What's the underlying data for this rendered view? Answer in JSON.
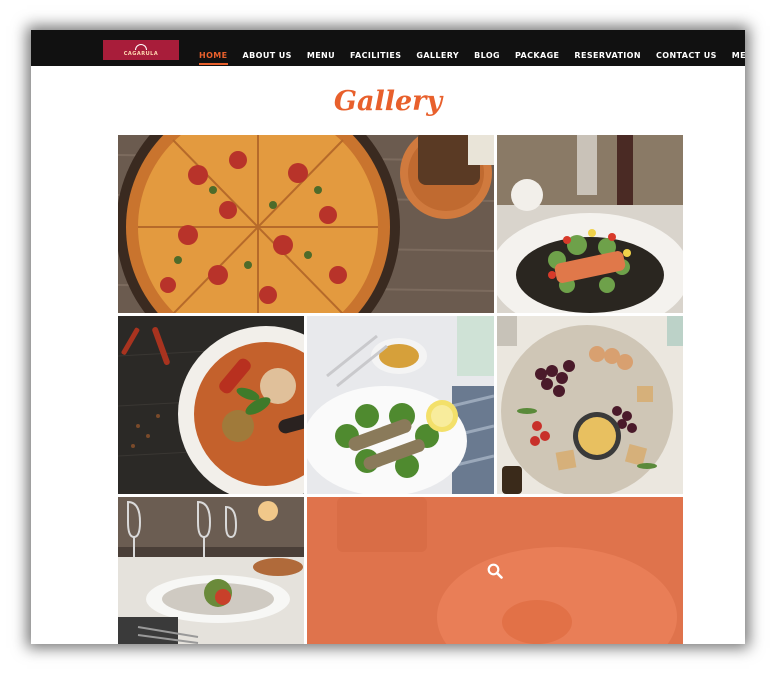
{
  "brand": {
    "logo_text": "CAGARULA"
  },
  "nav": {
    "items": [
      {
        "label": "HOME",
        "active": true
      },
      {
        "label": "ABOUT US"
      },
      {
        "label": "MENU"
      },
      {
        "label": "FACILITIES"
      },
      {
        "label": "GALLERY"
      },
      {
        "label": "BLOG"
      },
      {
        "label": "PACKAGE"
      },
      {
        "label": "RESERVATION"
      },
      {
        "label": "CONTACT US"
      },
      {
        "label": "MEMBER"
      }
    ]
  },
  "page": {
    "title": "Gallery"
  },
  "gallery": {
    "images": [
      {
        "subject": "pizza"
      },
      {
        "subject": "salmon-dish"
      },
      {
        "subject": "soup-bowl"
      },
      {
        "subject": "fish-salad"
      },
      {
        "subject": "charcuterie-board"
      },
      {
        "subject": "restaurant-table"
      },
      {
        "subject": "plate-hover",
        "hover_icon": "search-icon"
      }
    ]
  },
  "colors": {
    "accent": "#e8602c",
    "topbar": "#111111",
    "logo_bg": "#a81d3a"
  }
}
